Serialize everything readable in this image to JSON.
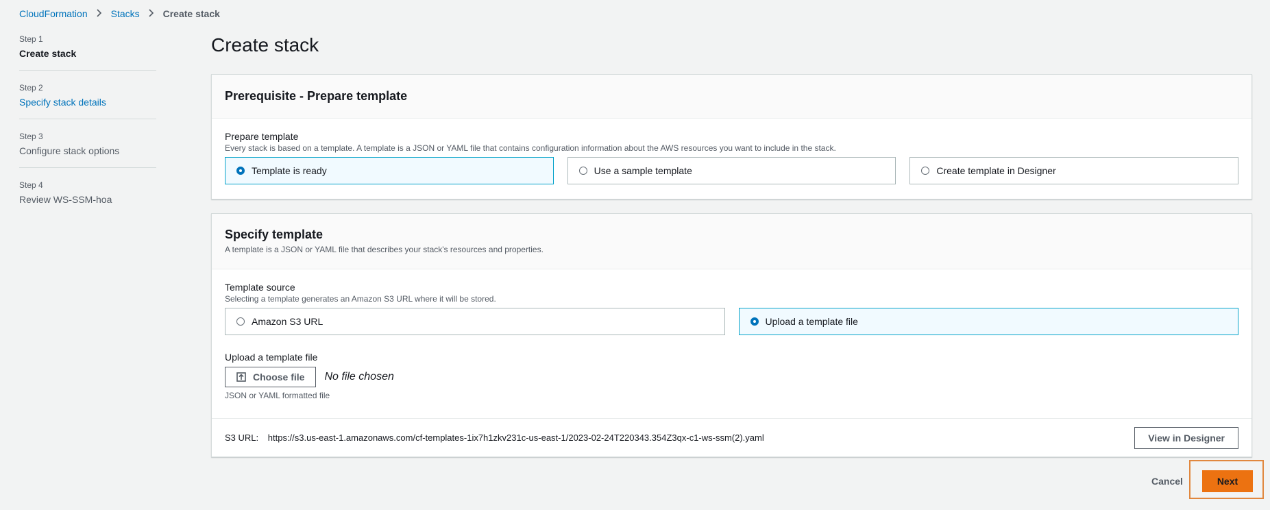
{
  "breadcrumb": {
    "items": [
      "CloudFormation",
      "Stacks"
    ],
    "current": "Create stack"
  },
  "steps": [
    {
      "num": "Step 1",
      "title": "Create stack"
    },
    {
      "num": "Step 2",
      "title": "Specify stack details"
    },
    {
      "num": "Step 3",
      "title": "Configure stack options"
    },
    {
      "num": "Step 4",
      "title": "Review WS-SSM-hoa"
    }
  ],
  "page_title": "Create stack",
  "prereq": {
    "title": "Prerequisite - Prepare template",
    "field_label": "Prepare template",
    "field_desc": "Every stack is based on a template. A template is a JSON or YAML file that contains configuration information about the AWS resources you want to include in the stack.",
    "options": [
      "Template is ready",
      "Use a sample template",
      "Create template in Designer"
    ],
    "selected": "Template is ready"
  },
  "specify": {
    "title": "Specify template",
    "desc": "A template is a JSON or YAML file that describes your stack's resources and properties.",
    "source_label": "Template source",
    "source_desc": "Selecting a template generates an Amazon S3 URL where it will be stored.",
    "options": [
      "Amazon S3 URL",
      "Upload a template file"
    ],
    "selected": "Upload a template file",
    "upload_label": "Upload a template file",
    "choose_file": "Choose file",
    "no_file": "No file chosen",
    "upload_hint": "JSON or YAML formatted file",
    "s3_label": "S3 URL:",
    "s3_url": "https://s3.us-east-1.amazonaws.com/cf-templates-1ix7h1zkv231c-us-east-1/2023-02-24T220343.354Z3qx-c1-ws-ssm(2).yaml",
    "view_designer": "View in Designer"
  },
  "actions": {
    "cancel": "Cancel",
    "next": "Next"
  },
  "colors": {
    "link": "#0073bb",
    "primary": "#ec7211",
    "highlight": "#e1873e",
    "selected_border": "#00a1c9"
  }
}
